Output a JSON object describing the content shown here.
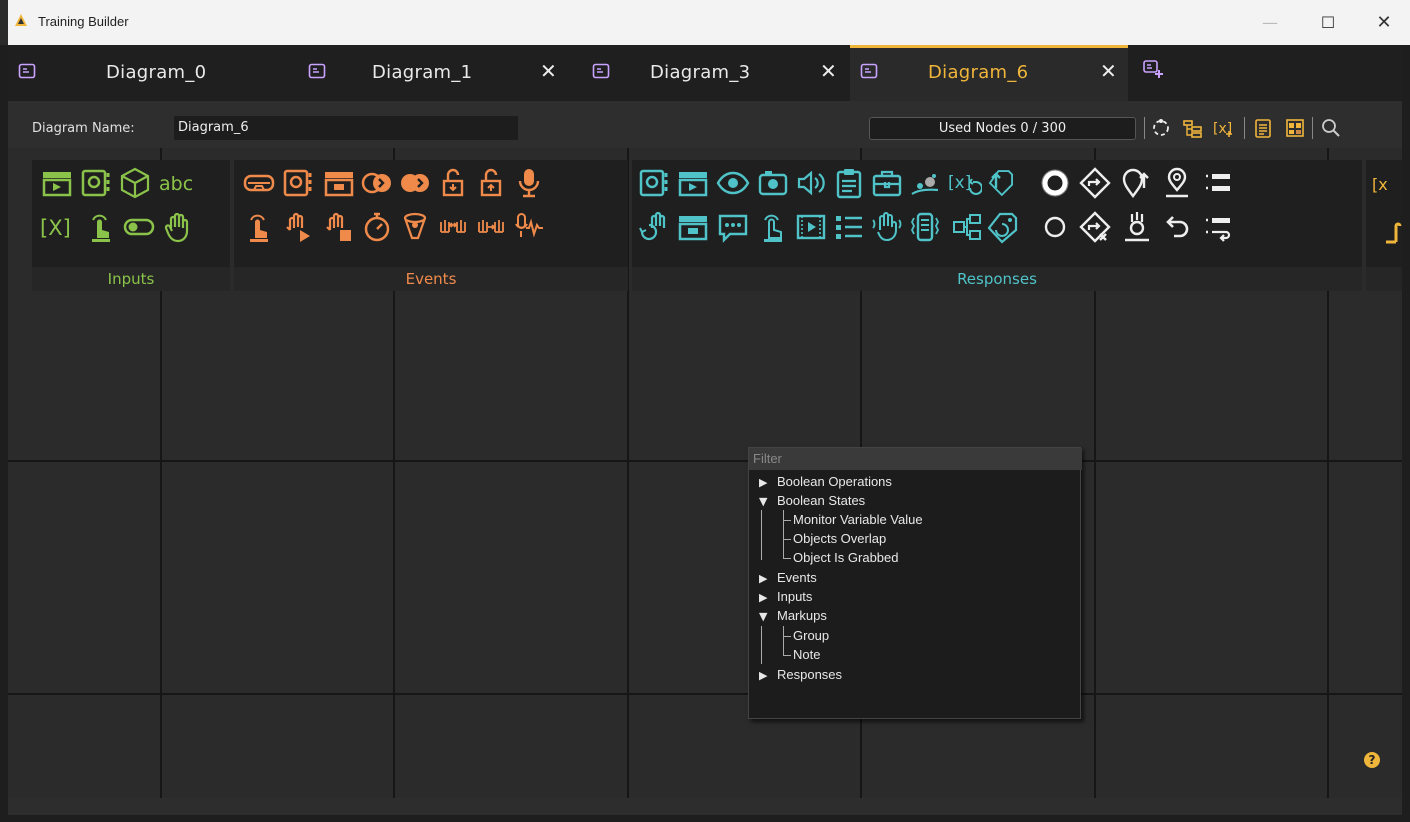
{
  "window": {
    "title": "Training Builder",
    "controls": {
      "minimize": "—",
      "maximize": "☐",
      "close": "✕"
    }
  },
  "tabs": [
    {
      "label": "Diagram_0",
      "closable": false,
      "active": false
    },
    {
      "label": "Diagram_1",
      "closable": true,
      "active": false
    },
    {
      "label": "Diagram_3",
      "closable": true,
      "active": false
    },
    {
      "label": "Diagram_6",
      "closable": true,
      "active": true
    }
  ],
  "tab_close_glyph": "✕",
  "toolbar": {
    "diagram_name_label": "Diagram Name:",
    "diagram_name_value": "Diagram_6",
    "used_nodes": "Used Nodes 0 / 300",
    "icons": [
      "layout-icon",
      "hierarchy-icon",
      "variable-add-icon",
      "clipboard-icon",
      "grid-view-icon",
      "search-icon"
    ]
  },
  "palettes": [
    {
      "label": "Inputs",
      "color": "#8bc34a"
    },
    {
      "label": "Events",
      "color": "#ef8a4a"
    },
    {
      "label": "Responses",
      "color": "#4fc3c8"
    }
  ],
  "filter": {
    "placeholder": "Filter",
    "tree": [
      {
        "label": "Boolean Operations",
        "expanded": false
      },
      {
        "label": "Boolean States",
        "expanded": true,
        "children": [
          "Monitor Variable Value",
          "Objects Overlap",
          "Object Is Grabbed"
        ]
      },
      {
        "label": "Events",
        "expanded": false
      },
      {
        "label": "Inputs",
        "expanded": false
      },
      {
        "label": "Markups",
        "expanded": true,
        "children": [
          "Group",
          "Note"
        ]
      },
      {
        "label": "Responses",
        "expanded": false
      }
    ]
  },
  "help_glyph": "?",
  "colors": {
    "accent": "#f0b53b",
    "inputs": "#8bc34a",
    "events": "#ef8a4a",
    "responses": "#4fc3c8",
    "tab_icon": "#b58ad8"
  }
}
